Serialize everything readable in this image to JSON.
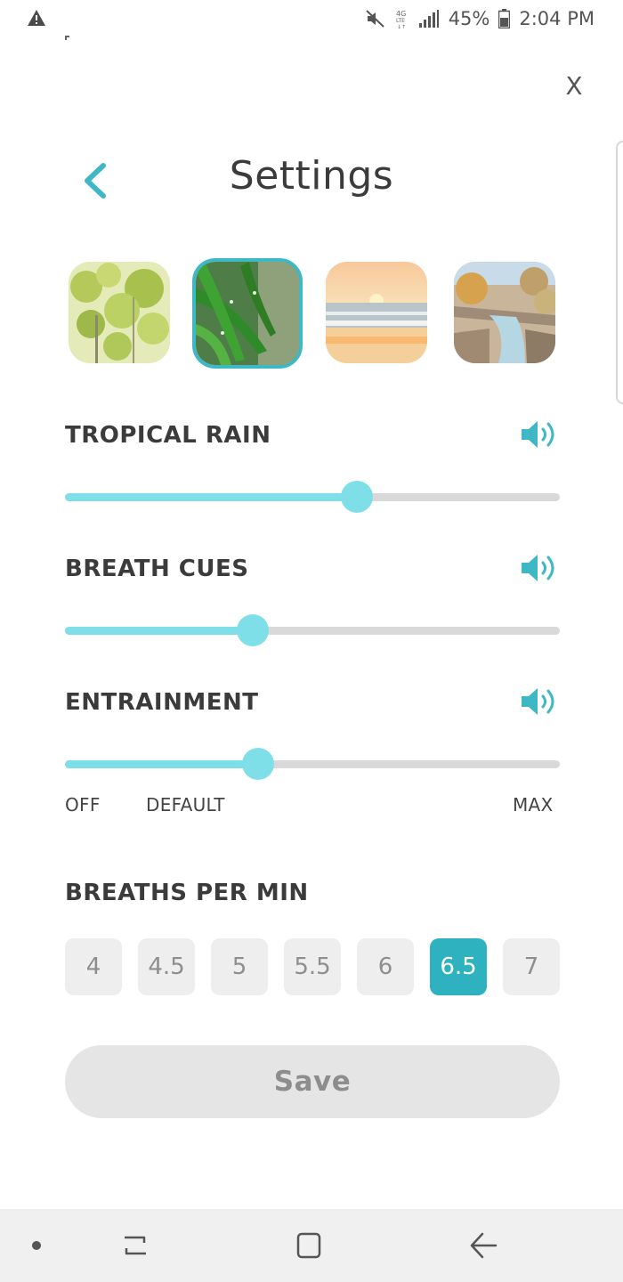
{
  "status_bar": {
    "battery_percent": "45%",
    "time": "2:04 PM",
    "network": "4G LTE"
  },
  "header": {
    "title": "Settings",
    "close_label": "X"
  },
  "scenes": [
    {
      "name": "Forest",
      "selected": false
    },
    {
      "name": "Tropical Rain",
      "selected": true
    },
    {
      "name": "Ocean Sunset",
      "selected": false
    },
    {
      "name": "River",
      "selected": false
    }
  ],
  "sound_controls": [
    {
      "label": "TROPICAL RAIN",
      "level_percent": 59
    },
    {
      "label": "BREATH CUES",
      "level_percent": 38
    },
    {
      "label": "ENTRAINMENT",
      "level_percent": 39
    }
  ],
  "entrainment_scale": {
    "min_label": "OFF",
    "default_label": "DEFAULT",
    "max_label": "MAX"
  },
  "breaths_per_min": {
    "label": "BREATHS PER MIN",
    "options": [
      "4",
      "4.5",
      "5",
      "5.5",
      "6",
      "6.5",
      "7"
    ],
    "selected": "6.5"
  },
  "save_button": {
    "label": "Save"
  },
  "colors": {
    "accent": "#3fb8c5",
    "slider_fill": "#7fdfe8",
    "track": "#d9d9d9",
    "selected_option": "#2fb2c0"
  },
  "icons": {
    "status_warning": "warning-icon",
    "mute": "mute-icon",
    "volume": "speaker-icon",
    "back": "chevron-left-icon",
    "close": "close-icon"
  }
}
